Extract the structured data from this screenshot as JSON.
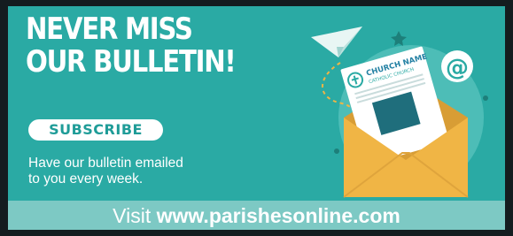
{
  "banner": {
    "headline_line1": "NEVER MISS",
    "headline_line2": "OUR BULLETIN!",
    "subscribe_label": "SUBSCRIBE",
    "description_line1": "Have our bulletin emailed",
    "description_line2": "to you every week.",
    "footer_prefix": "Visit",
    "footer_url": "www.parishesonline.com"
  },
  "bulletin": {
    "title": "CHURCH NAME",
    "subtitle": "CATHOLIC CHURCH"
  },
  "icons": {
    "paper_plane": "paper-plane-icon",
    "at_sign": "at-sign-icon",
    "envelope": "envelope-icon",
    "cross": "cross-icon"
  },
  "colors": {
    "panel": "#2aaaa4",
    "footer": "#7dc9c4",
    "envelope": "#f0b545",
    "envelope_dark": "#d89d35",
    "subscribe_text": "#1f9c98",
    "frame": "#141c1f"
  }
}
